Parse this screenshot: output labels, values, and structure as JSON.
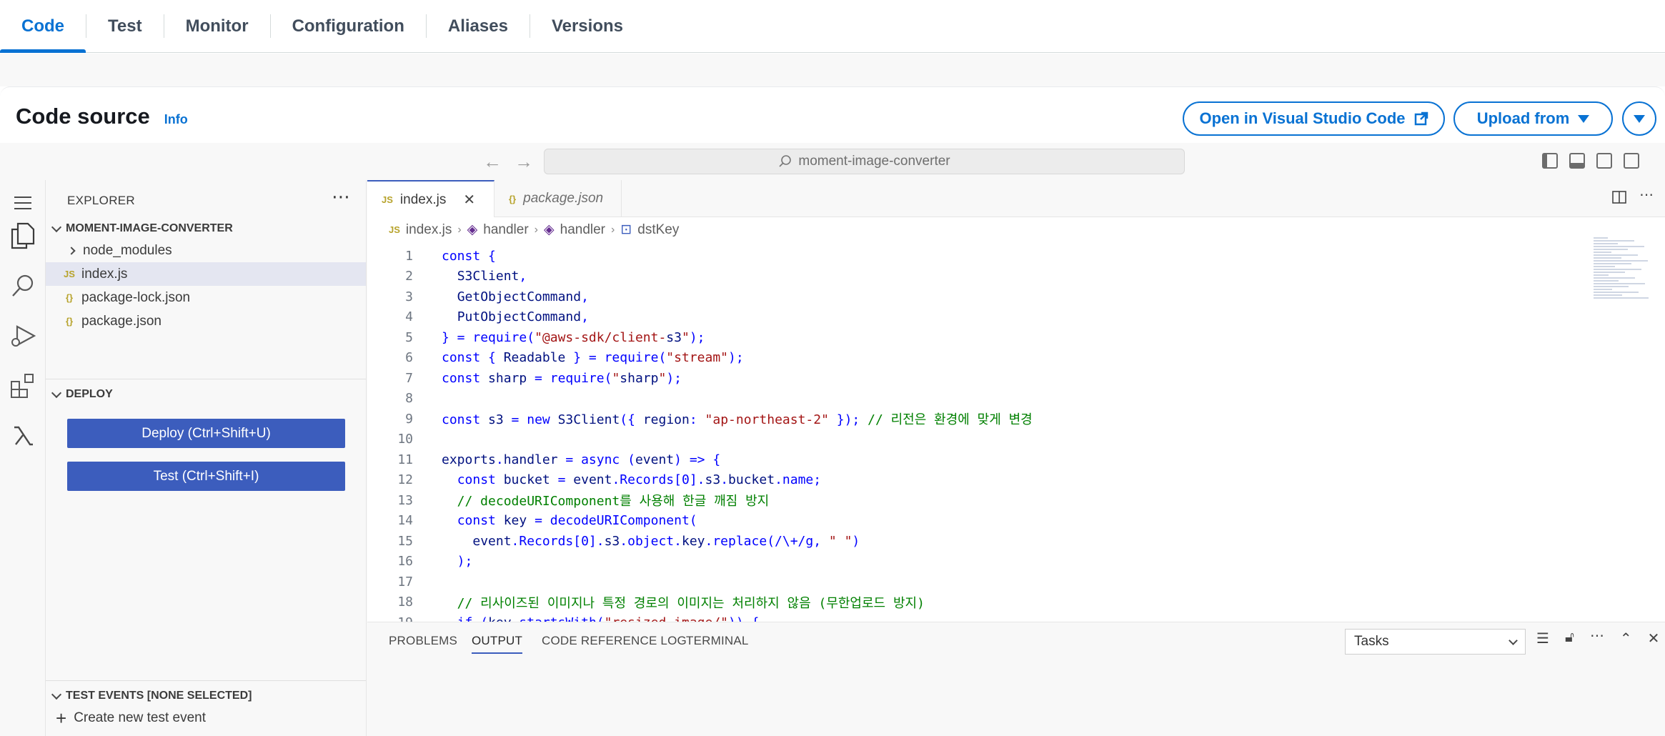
{
  "tabs": [
    {
      "label": "Code",
      "active": true
    },
    {
      "label": "Test"
    },
    {
      "label": "Monitor"
    },
    {
      "label": "Configuration"
    },
    {
      "label": "Aliases"
    },
    {
      "label": "Versions"
    }
  ],
  "header": {
    "title": "Code source",
    "info": "Info",
    "open_vscode": "Open in Visual Studio Code",
    "upload_from": "Upload from"
  },
  "ide": {
    "command_center": "moment-image-converter",
    "explorer_title": "EXPLORER",
    "project_name": "MOMENT-IMAGE-CONVERTER",
    "files": [
      {
        "name": "node_modules",
        "type": "folder"
      },
      {
        "name": "index.js",
        "type": "js",
        "selected": true
      },
      {
        "name": "package-lock.json",
        "type": "json"
      },
      {
        "name": "package.json",
        "type": "json"
      }
    ],
    "deploy_section": "DEPLOY",
    "deploy_button": "Deploy (Ctrl+Shift+U)",
    "test_button": "Test (Ctrl+Shift+I)",
    "test_events_section": "TEST EVENTS [NONE SELECTED]",
    "create_test_event": "Create new test event",
    "editor_tabs": [
      {
        "label": "index.js",
        "active": true
      },
      {
        "label": "package.json"
      }
    ],
    "breadcrumb": [
      "index.js",
      "handler",
      "handler",
      "dstKey"
    ],
    "code_lines": [
      "const {",
      "  S3Client,",
      "  GetObjectCommand,",
      "  PutObjectCommand,",
      "} = require(\"@aws-sdk/client-s3\");",
      "const { Readable } = require(\"stream\");",
      "const sharp = require(\"sharp\");",
      "",
      "const s3 = new S3Client({ region: \"ap-northeast-2\" }); // 리전은 환경에 맞게 변경",
      "",
      "exports.handler = async (event) => {",
      "  const bucket = event.Records[0].s3.bucket.name;",
      "  // decodeURIComponent를 사용해 한글 깨짐 방지",
      "  const key = decodeURIComponent(",
      "    event.Records[0].s3.object.key.replace(/\\+/g, \" \")",
      "  );",
      "",
      "  // 리사이즈된 이미지나 특정 경로의 이미지는 처리하지 않음 (무한업로드 방지)",
      "  if (key.startsWith(\"resized-image/\")) {"
    ],
    "panel_tabs": [
      "PROBLEMS",
      "OUTPUT",
      "CODE REFERENCE LOG",
      "TERMINAL"
    ],
    "panel_active": "OUTPUT",
    "task_select": "Tasks"
  },
  "colors": {
    "accent": "#0972d3",
    "deploy_btn": "#3c5dbd"
  }
}
